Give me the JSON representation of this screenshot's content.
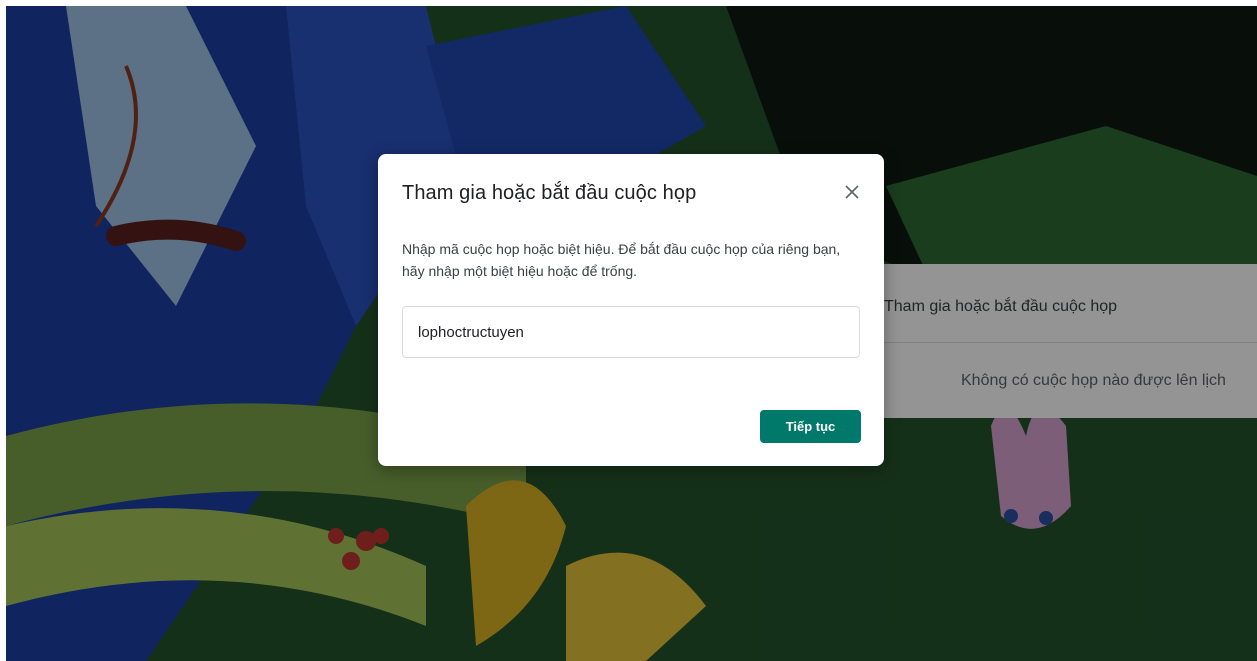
{
  "background": {
    "card_title": "Tham gia hoặc bắt đầu cuộc họp",
    "card_empty_text": "Không có cuộc họp nào được lên lịch"
  },
  "dialog": {
    "title": "Tham gia hoặc bắt đầu cuộc họp",
    "close_icon": "close-icon",
    "description": "Nhập mã cuộc họp hoặc biệt hiệu. Để bắt đầu cuộc họp của riêng bạn, hãy nhập một biệt hiệu hoặc để trống.",
    "input_value": "lophoctructuyen",
    "continue_label": "Tiếp tục"
  },
  "colors": {
    "accent": "#00796b",
    "overlay": "#000000"
  }
}
